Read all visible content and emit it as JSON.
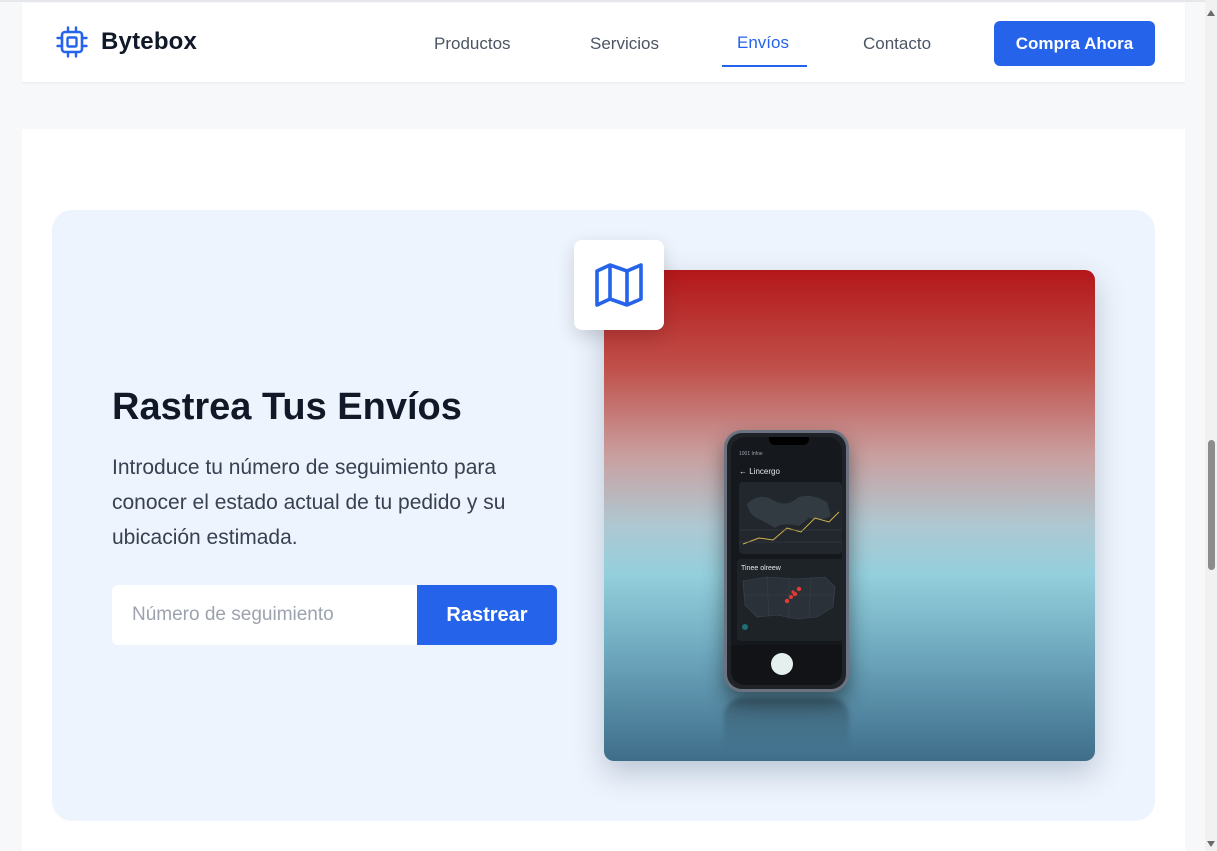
{
  "brand": {
    "name": "Bytebox",
    "icon": "chip-icon",
    "accent_color": "#2563eb"
  },
  "nav": {
    "items": [
      {
        "label": "Productos",
        "active": false
      },
      {
        "label": "Servicios",
        "active": false
      },
      {
        "label": "Envíos",
        "active": true
      },
      {
        "label": "Contacto",
        "active": false
      }
    ],
    "cta_label": "Compra Ahora"
  },
  "hero": {
    "title": "Rastrea Tus Envíos",
    "description": "Introduce tu número de seguimiento para conocer el estado actual de tu pedido y su ubicación estimada.",
    "tracking_input": {
      "value": "",
      "placeholder": "Número de seguimiento"
    },
    "track_button_label": "Rastrear",
    "badge_icon": "map-icon",
    "image": {
      "phone_screen_title": "← Lincergo",
      "phone_status": "1001    Infoe",
      "phone_panel_title": "Tinee olreew"
    }
  },
  "colors": {
    "card_background": "#eef4fd",
    "page_background": "#f7f8fa",
    "primary_button": "#2563eb"
  }
}
